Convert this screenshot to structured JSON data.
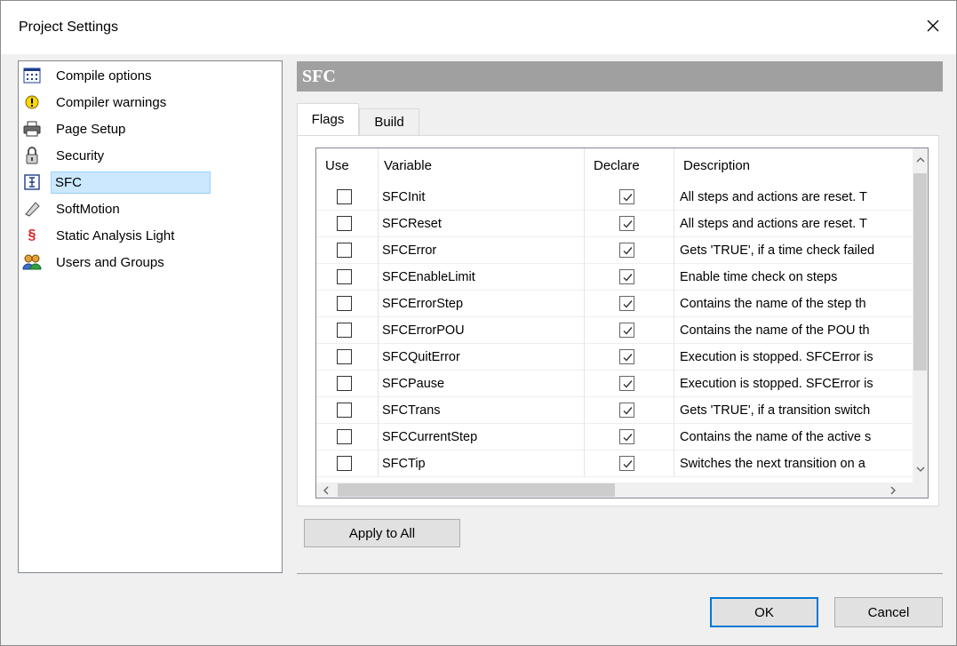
{
  "window": {
    "title": "Project Settings"
  },
  "tree": {
    "items": [
      {
        "label": "Compile options",
        "icon": "compile-options-icon"
      },
      {
        "label": "Compiler warnings",
        "icon": "warning-icon"
      },
      {
        "label": "Page Setup",
        "icon": "printer-icon"
      },
      {
        "label": "Security",
        "icon": "lock-icon"
      },
      {
        "label": "SFC",
        "icon": "sfc-icon",
        "selected": true
      },
      {
        "label": "SoftMotion",
        "icon": "softmotion-icon"
      },
      {
        "label": "Static Analysis Light",
        "icon": "paragraph-icon"
      },
      {
        "label": "Users and Groups",
        "icon": "users-icon"
      }
    ]
  },
  "section": {
    "title": "SFC"
  },
  "tabs": [
    {
      "label": "Flags",
      "active": true
    },
    {
      "label": "Build",
      "active": false
    }
  ],
  "grid": {
    "columns": [
      "Use",
      "Variable",
      "Declare",
      "Description"
    ],
    "rows": [
      {
        "use": false,
        "variable": "SFCInit",
        "declare": true,
        "description": "All steps and actions are reset. T"
      },
      {
        "use": false,
        "variable": "SFCReset",
        "declare": true,
        "description": "All steps and actions are reset. T"
      },
      {
        "use": false,
        "variable": "SFCError",
        "declare": true,
        "description": "Gets 'TRUE', if a time check failed"
      },
      {
        "use": false,
        "variable": "SFCEnableLimit",
        "declare": true,
        "description": "Enable time check on steps"
      },
      {
        "use": false,
        "variable": "SFCErrorStep",
        "declare": true,
        "description": "Contains the name of the step th"
      },
      {
        "use": false,
        "variable": "SFCErrorPOU",
        "declare": true,
        "description": "Contains the name of the POU th"
      },
      {
        "use": false,
        "variable": "SFCQuitError",
        "declare": true,
        "description": "Execution is stopped. SFCError is"
      },
      {
        "use": false,
        "variable": "SFCPause",
        "declare": true,
        "description": "Execution is stopped. SFCError is"
      },
      {
        "use": false,
        "variable": "SFCTrans",
        "declare": true,
        "description": "Gets 'TRUE', if a transition switch"
      },
      {
        "use": false,
        "variable": "SFCCurrentStep",
        "declare": true,
        "description": "Contains the name of the active s"
      },
      {
        "use": false,
        "variable": "SFCTip",
        "declare": true,
        "description": "Switches the next transition on a"
      }
    ]
  },
  "buttons": {
    "apply_all": "Apply to All",
    "ok": "OK",
    "cancel": "Cancel"
  },
  "colors": {
    "header_bg": "#a0a0a0",
    "selected_bg": "#cce8ff",
    "default_button_border": "#0078d7"
  }
}
